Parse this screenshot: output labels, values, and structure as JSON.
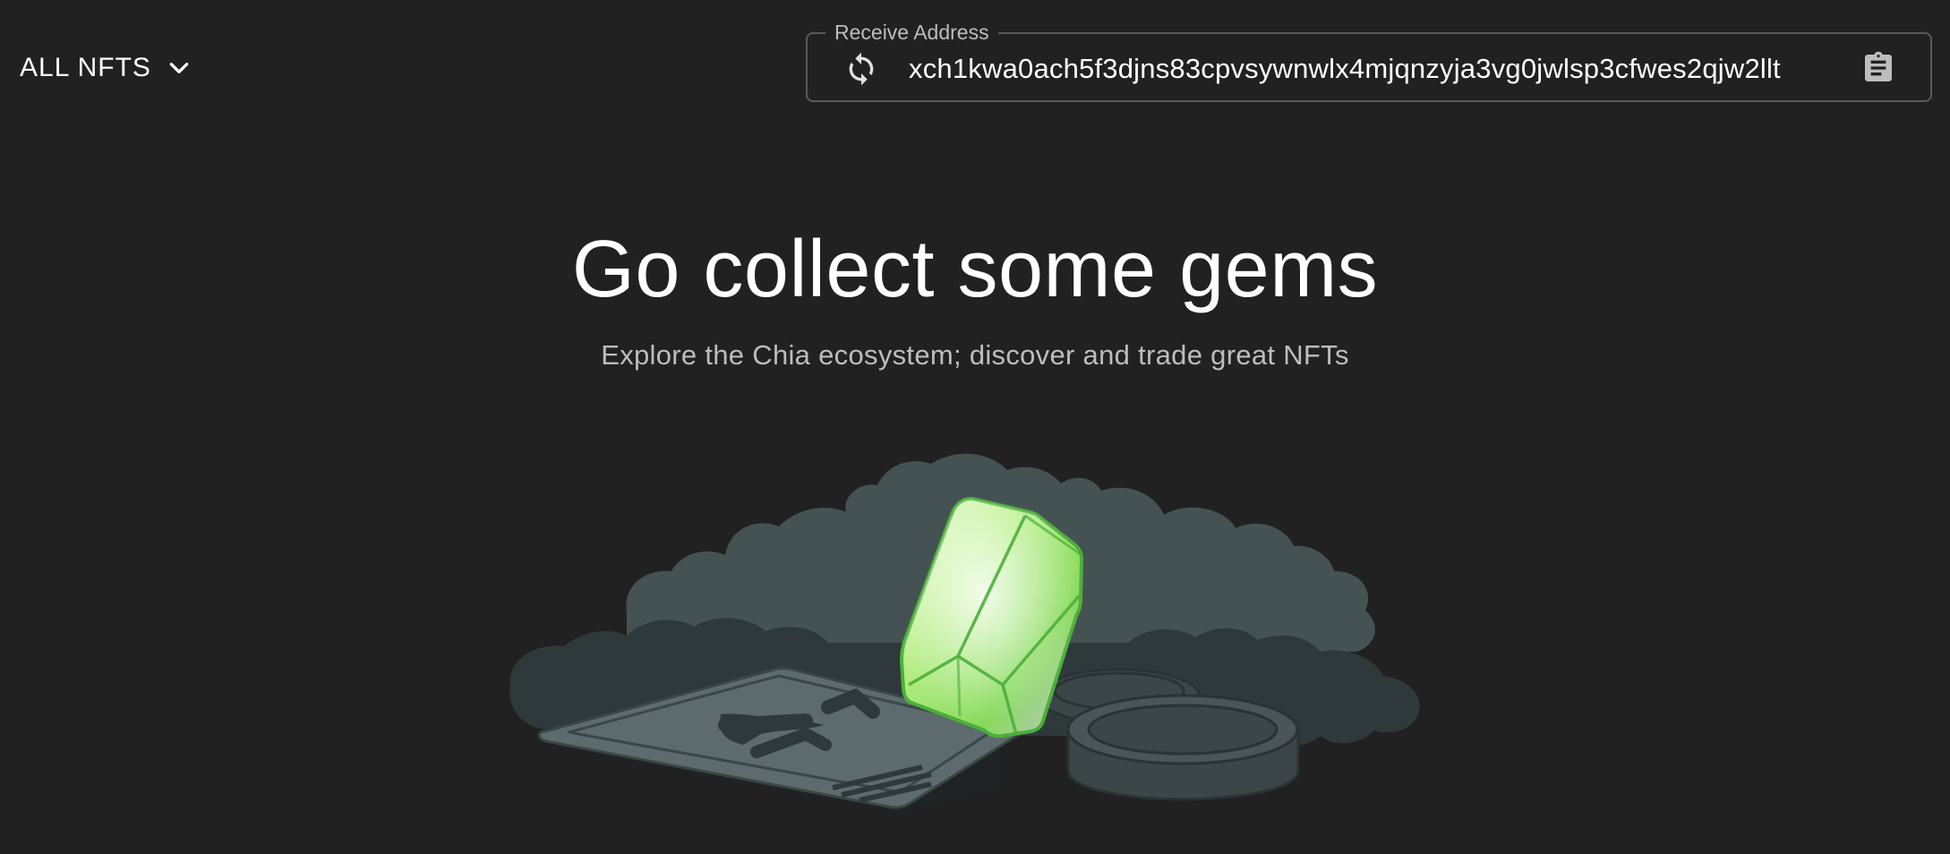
{
  "filter": {
    "label": "ALL NFTS",
    "icon": "chevron-down-icon"
  },
  "receive_address": {
    "label": "Receive Address",
    "value": "xch1kwa0ach5f3djns83cpvsywnwlx4mjqnzyja3vg0jwlsp3cfwes2qjw2llt",
    "refresh_icon": "refresh-icon",
    "copy_icon": "clipboard-icon"
  },
  "empty_state": {
    "title": "Go collect some gems",
    "subtitle": "Explore the Chia ecosystem; discover and trade great NFTs",
    "illustration_icon": "gem-illustration"
  },
  "colors": {
    "background": "#212121",
    "cloud": "#455254",
    "gem": "#7ed957",
    "card": "#5e6b6e"
  }
}
